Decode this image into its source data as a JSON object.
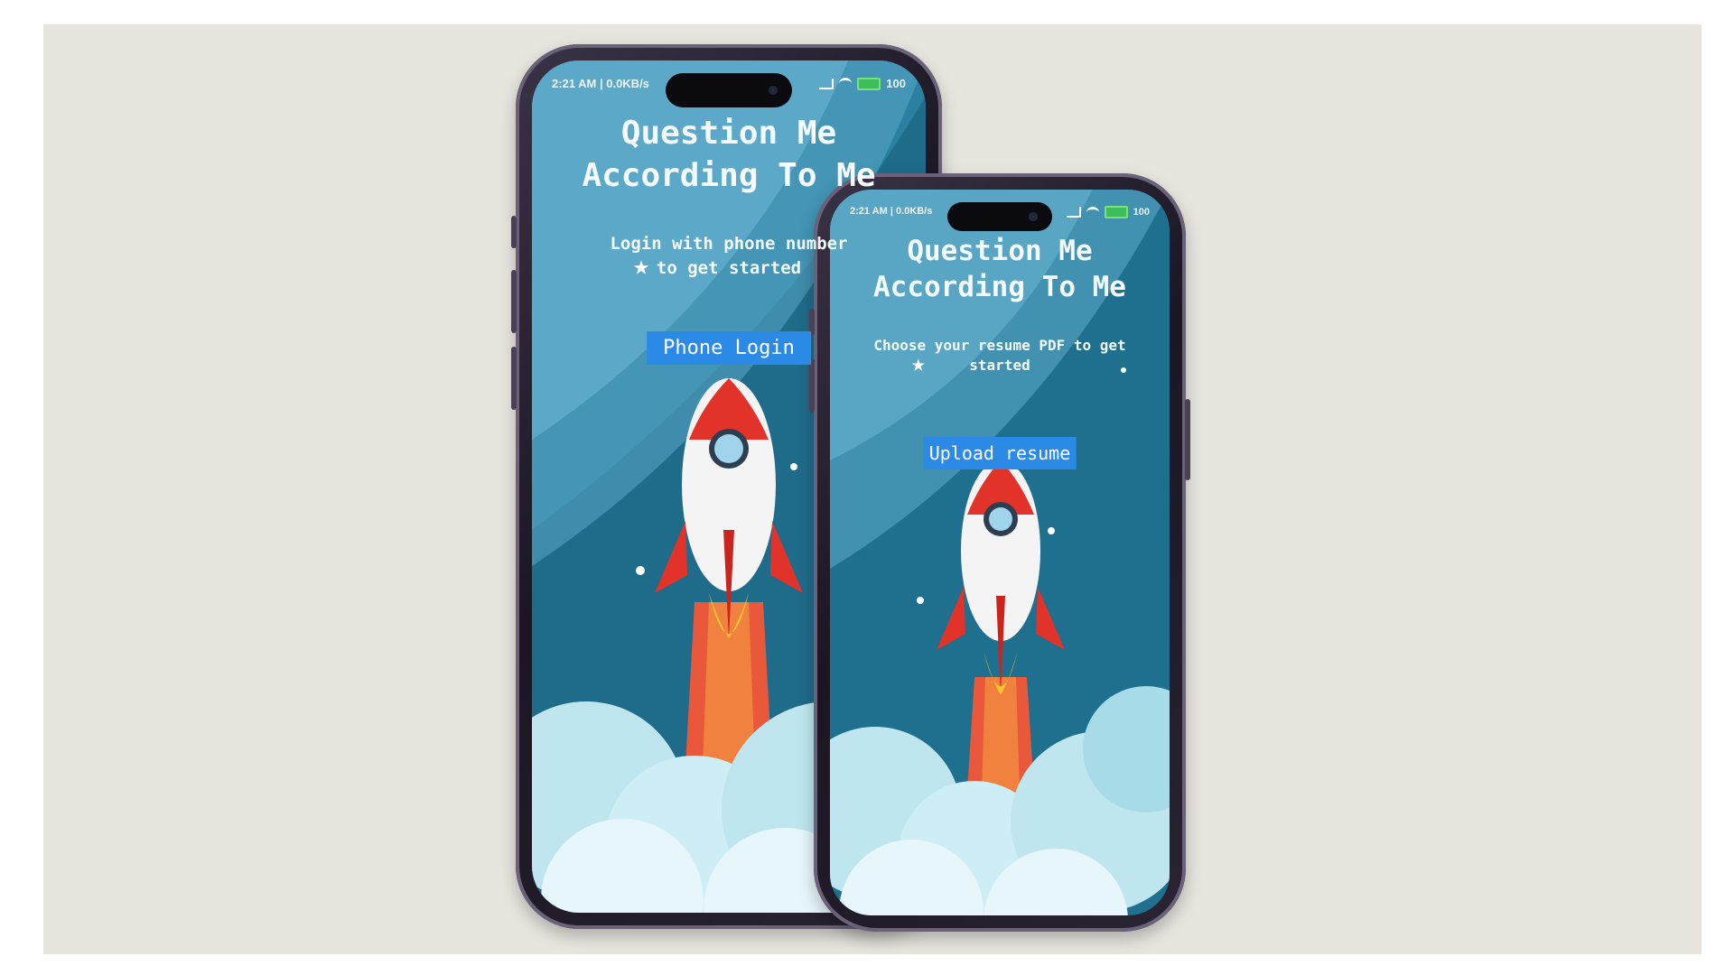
{
  "phone_large": {
    "status_left": "2:21 AM | 0.0KB/s",
    "status_right": "100",
    "title_line1": "Question Me",
    "title_line2": "According To Me",
    "subtitle": "Login with phone number to get started",
    "button_label": "Phone Login",
    "star_icon": "star-icon"
  },
  "phone_small": {
    "status_left": "2:21 AM | 0.0KB/s",
    "status_right": "100",
    "title_line1": "Question Me",
    "title_line2": "According To Me",
    "subtitle": "Choose your resume PDF to get started",
    "button_label": "Upload resume",
    "star_icon": "star-icon"
  },
  "colors": {
    "background": "#e8e5df",
    "screen_blue": "#2b7a9a",
    "button_blue": "#2a8ae6",
    "rocket_red": "#e2332b",
    "cloud": "#bfe6ef"
  }
}
